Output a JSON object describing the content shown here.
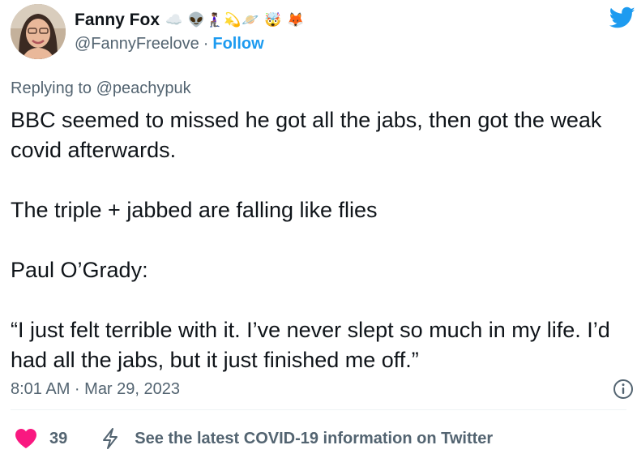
{
  "author": {
    "display_name": "Fanny Fox",
    "emojis": "☁️ 👽🧎🏾‍♀️💫🪐 🤯 🦊",
    "handle": "@FannyFreelove",
    "separator": "·",
    "follow_label": "Follow",
    "avatar_icon": "profile-photo"
  },
  "reply": {
    "prefix": "Replying to ",
    "mention": "@peachypuk"
  },
  "tweet": {
    "paragraphs": [
      "BBC seemed to missed he got all the jabs, then got the weak covid afterwards.",
      "The triple + jabbed are falling like flies",
      "Paul O’Grady:",
      "“I just felt terrible with it. I’ve never slept so much in my life. I’d had all the jabs, but it just finished me off.”"
    ],
    "timestamp": "8:01 AM · Mar 29, 2023"
  },
  "actions": {
    "like_count": "39",
    "covid_info": "See the latest COVID-19 information on Twitter"
  },
  "icons": {
    "brand": "twitter-bird-icon",
    "info": "info-icon",
    "like": "heart-icon",
    "covid": "bolt-icon"
  },
  "colors": {
    "twitter_blue": "#1d9bf0",
    "text_primary": "#0f1419",
    "text_secondary": "#536471",
    "like_red": "#f91880",
    "divider": "#eff3f4"
  }
}
